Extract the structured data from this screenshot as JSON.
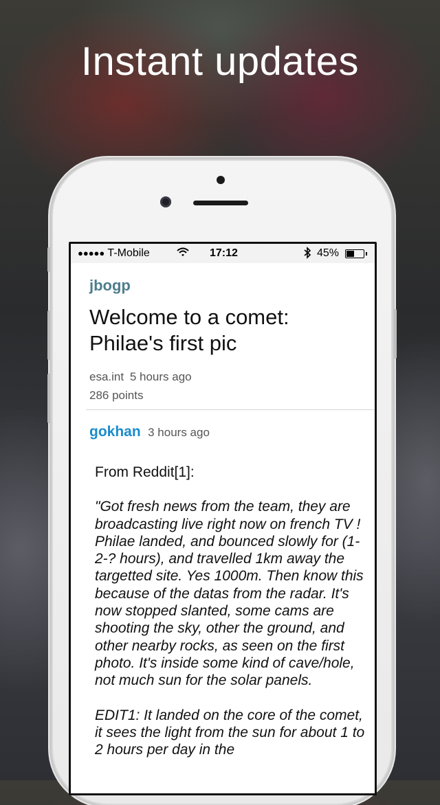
{
  "headline": "Instant updates",
  "status_bar": {
    "signal_dots": "●●●●●",
    "carrier": "T-Mobile",
    "time": "17:12",
    "battery_percent": "45%",
    "battery_level": 0.45
  },
  "post": {
    "user": "jbogp",
    "title": "Welcome to a comet: Philae's first pic",
    "domain": "esa.int",
    "age": "5 hours ago",
    "points": "286 points"
  },
  "comment": {
    "user": "gokhan",
    "age": "3 hours ago",
    "intro": "From Reddit[1]:",
    "quote": "\"Got fresh news from the team, they are broadcasting live right now on french TV ! Philae landed, and bounced slowly for (1-2-? hours), and travelled 1km away the targetted site. Yes 1000m. Then know this because of the datas from the radar. It's now stopped slanted, some cams are shooting the sky, other the ground, and other nearby rocks, as seen on the first photo. It's inside some kind of cave/hole, not much sun for the solar panels.",
    "edit": "EDIT1: It landed on the core of the comet, it sees the light from the sun for about 1 to 2 hours per day in the"
  }
}
